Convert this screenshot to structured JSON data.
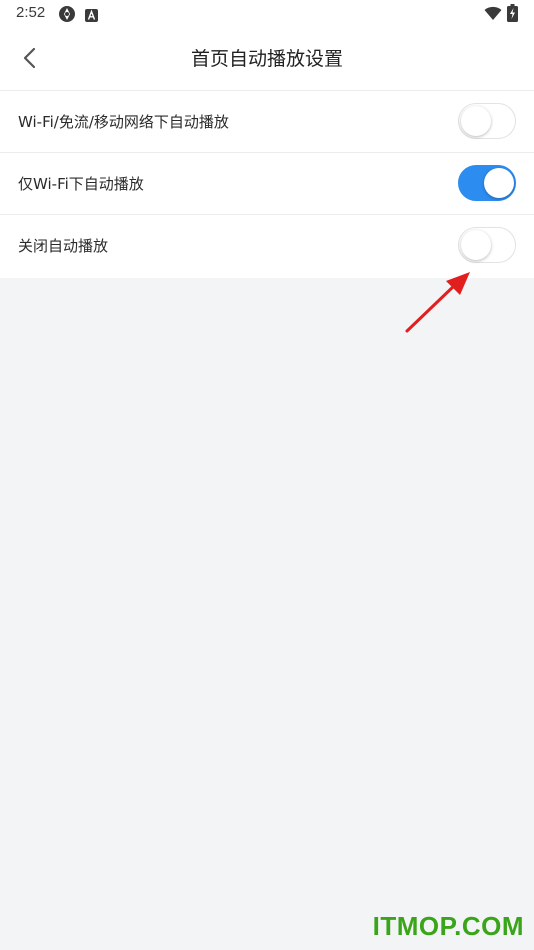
{
  "status_bar": {
    "time": "2:52",
    "icons": [
      "cast-app-icon",
      "a-app-icon",
      "wifi-icon",
      "battery-charging-icon"
    ]
  },
  "header": {
    "title": "首页自动播放设置",
    "back_icon": "chevron-left-icon"
  },
  "settings": {
    "items": [
      {
        "label": "Wi-Fi/免流/移动网络下自动播放",
        "enabled": false
      },
      {
        "label": "仅Wi-Fi下自动播放",
        "enabled": true
      },
      {
        "label": "关闭自动播放",
        "enabled": false
      }
    ]
  },
  "annotation": {
    "type": "red-arrow-icon",
    "color": "#e21f1f"
  },
  "watermark": {
    "text": "ITMOP.COM",
    "color": "#3aa51a"
  },
  "colors": {
    "accent": "#2d8cf0",
    "background": "#f3f4f6",
    "surface": "#ffffff"
  }
}
